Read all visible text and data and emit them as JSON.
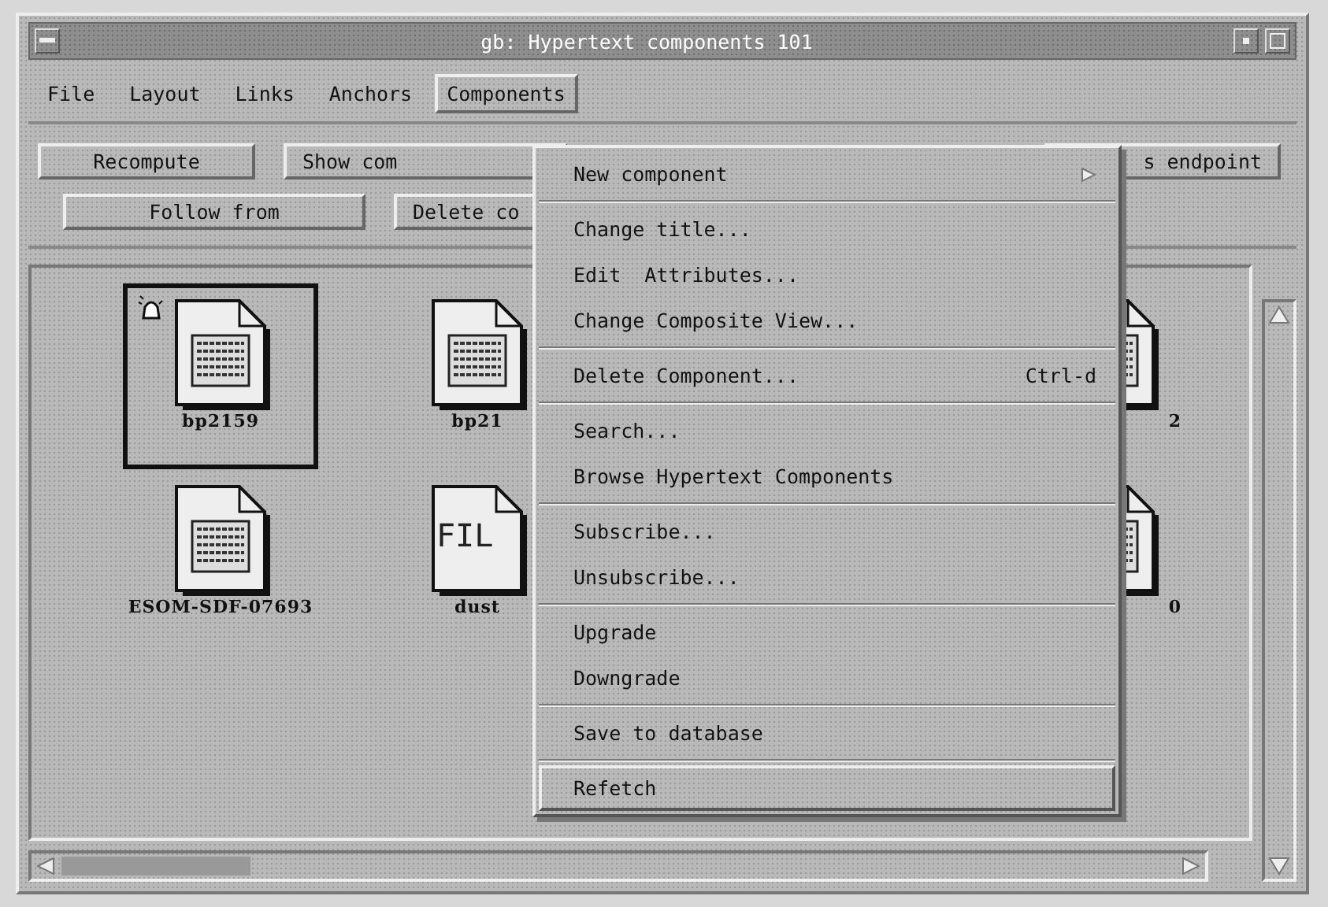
{
  "window": {
    "title": "gb: Hypertext components 101"
  },
  "menu_bar": [
    {
      "label": "File",
      "selected": false
    },
    {
      "label": "Layout",
      "selected": false
    },
    {
      "label": "Links",
      "selected": false
    },
    {
      "label": "Anchors",
      "selected": false
    },
    {
      "label": "Components",
      "selected": true
    }
  ],
  "button_rows": [
    [
      "Recompute",
      "Show com",
      "s endpoint"
    ],
    [
      "Follow from",
      "Delete co"
    ]
  ],
  "component_rows": [
    [
      {
        "label": "bp2159",
        "kind": "document",
        "selected": true,
        "alert": true
      },
      {
        "label": "bp21",
        "kind": "document",
        "selected": false,
        "alert": false
      },
      {
        "label": "2",
        "kind": "document",
        "selected": false,
        "alert": false
      }
    ],
    [
      {
        "label": "ESOM-SDF-07693",
        "kind": "document",
        "selected": false,
        "alert": false
      },
      {
        "label": "dust",
        "kind": "text-file",
        "icon_text": "FIL",
        "selected": false,
        "alert": false
      },
      {
        "label": "0",
        "kind": "document",
        "selected": false,
        "alert": false
      }
    ]
  ],
  "components_menu": [
    [
      {
        "label": "New component",
        "submenu": true,
        "selected": false
      }
    ],
    [
      {
        "label": "Change title...",
        "selected": false
      },
      {
        "label": "Edit  Attributes...",
        "selected": false
      },
      {
        "label": "Change Composite View...",
        "selected": false
      }
    ],
    [
      {
        "label": "Delete Component...",
        "shortcut": "Ctrl-d",
        "selected": false
      }
    ],
    [
      {
        "label": "Search...",
        "selected": false
      },
      {
        "label": "Browse Hypertext Components",
        "selected": false
      }
    ],
    [
      {
        "label": "Subscribe...",
        "selected": false
      },
      {
        "label": "Unsubscribe...",
        "selected": false
      }
    ],
    [
      {
        "label": "Upgrade",
        "selected": false
      },
      {
        "label": "Downgrade",
        "selected": false
      }
    ],
    [
      {
        "label": "Save to database",
        "selected": false
      }
    ],
    [
      {
        "label": "Refetch",
        "selected": true
      }
    ]
  ]
}
